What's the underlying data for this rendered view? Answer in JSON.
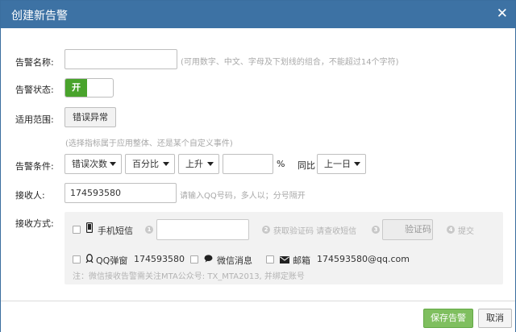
{
  "dialog": {
    "title": "创建新告警",
    "close_symbol": "✕"
  },
  "form": {
    "name": {
      "label": "告警名称:",
      "value": "",
      "hint": "(可用数字、中文、字母及下划线的组合，不能超过14个字符)"
    },
    "status": {
      "label": "告警状态:",
      "toggle_label": "开",
      "enabled": true
    },
    "scope": {
      "label": "适用范围:",
      "button_label": "错误异常",
      "hint": "(选择指标属于应用整体、还是某个自定义事件)"
    },
    "condition": {
      "label": "告警条件:",
      "metric": "错误次数",
      "type": "百分比",
      "direction": "上升",
      "value": "",
      "unit": "%",
      "compare_label": "同比",
      "period": "上一日"
    },
    "receiver": {
      "label": "接收人:",
      "value": "174593580",
      "hint": "请输入QQ号码，多人以；分号隔开"
    },
    "method": {
      "label": "接收方式:",
      "sms": {
        "label": "手机短信",
        "checked": false,
        "step1": "1",
        "phone_value": "",
        "step2": "2",
        "step2_text": "获取验证码 请查收短信",
        "step3": "3",
        "code_button": "验证码",
        "step4": "4",
        "step4_text": "提交"
      },
      "qq": {
        "label": "QQ弹窗",
        "value": "174593580",
        "checked": false
      },
      "wechat": {
        "label": "微信消息",
        "checked": false
      },
      "email": {
        "label": "邮箱",
        "value": "174593580@qq.com",
        "checked": false
      },
      "note": "注：微信接收告警需关注MTA公众号: TX_MTA2013, 并绑定账号"
    }
  },
  "footer": {
    "save_label": "保存告警",
    "cancel_label": "取消"
  },
  "colors": {
    "titlebar": "#3d72a4",
    "toggle_on": "#49a32c",
    "save_button": "#7fbf5f"
  }
}
